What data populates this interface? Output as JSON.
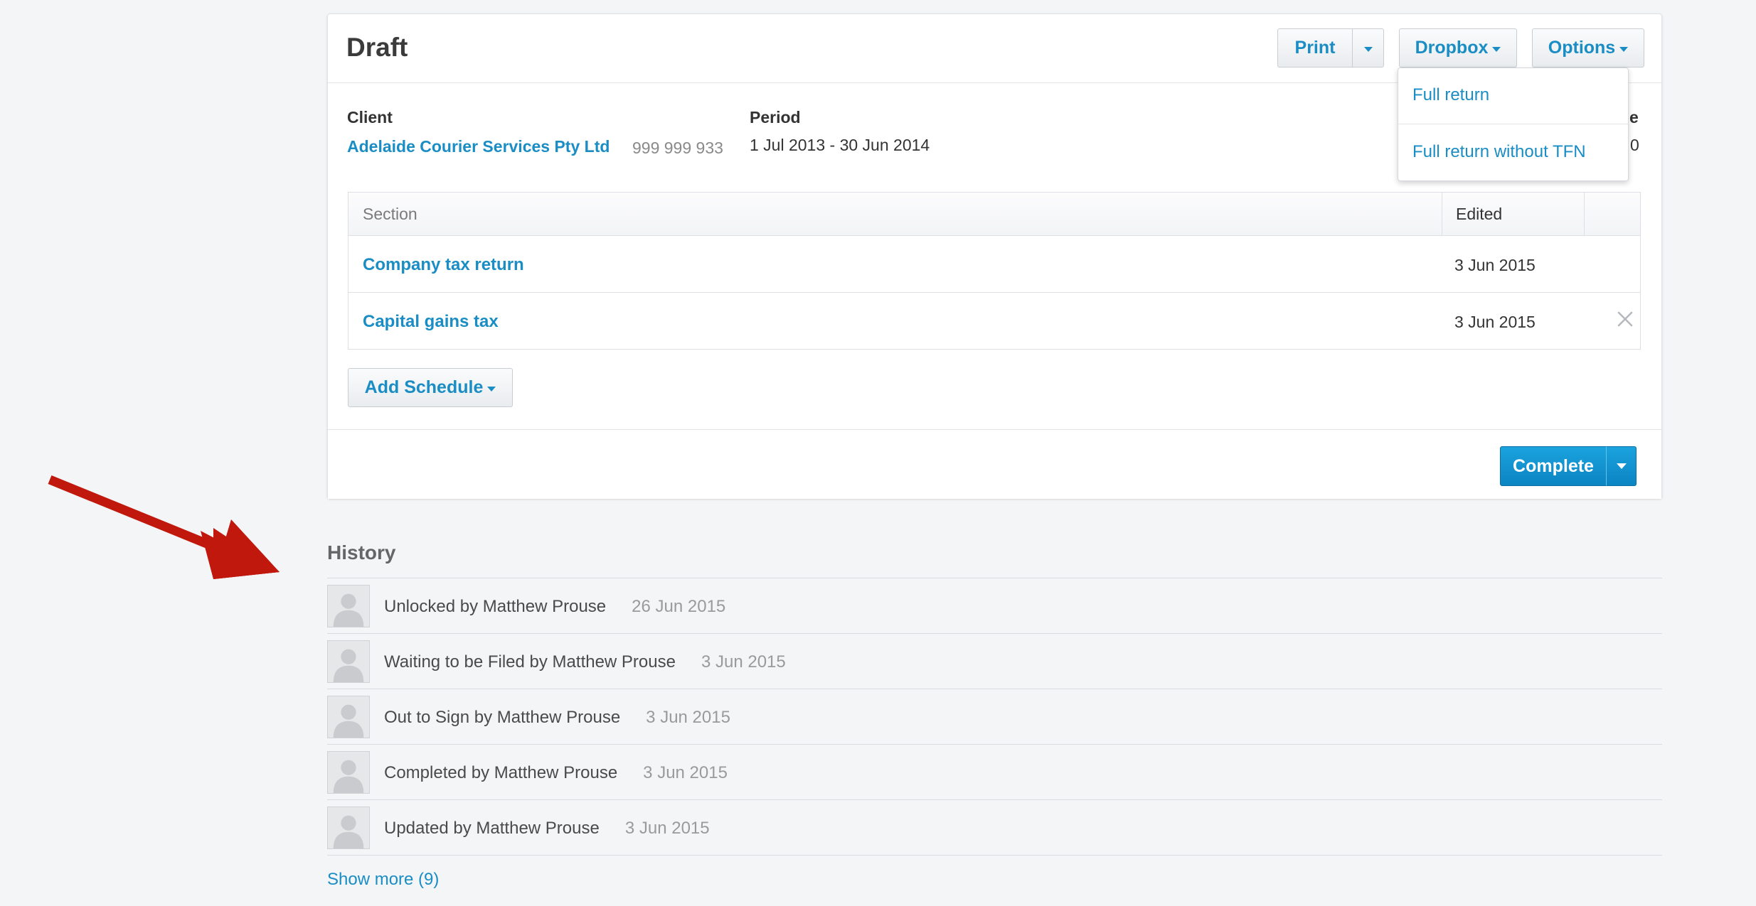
{
  "header": {
    "title": "Draft",
    "print_label": "Print",
    "dropbox_label": "Dropbox",
    "options_label": "Options"
  },
  "dropdown": {
    "items": [
      {
        "label": "Full return"
      },
      {
        "label": "Full return without TFN"
      }
    ]
  },
  "details": {
    "client_label": "Client",
    "client_name": "Adelaide Courier Services Pty Ltd",
    "client_abn": "999 999 933",
    "period_label": "Period",
    "period_value": "1 Jul 2013 - 30 Jun 2014",
    "partial_label": "e",
    "partial_value": "0"
  },
  "sections_table": {
    "headers": {
      "section": "Section",
      "edited": "Edited"
    },
    "rows": [
      {
        "name": "Company tax return",
        "edited": "3 Jun 2015",
        "deletable": false
      },
      {
        "name": "Capital gains tax",
        "edited": "3 Jun 2015",
        "deletable": true
      }
    ]
  },
  "add_schedule_label": "Add Schedule",
  "complete_label": "Complete",
  "history": {
    "title": "History",
    "items": [
      {
        "text": "Unlocked by Matthew Prouse",
        "date": "26 Jun 2015"
      },
      {
        "text": "Waiting to be Filed by Matthew Prouse",
        "date": "3 Jun 2015"
      },
      {
        "text": "Out to Sign by Matthew Prouse",
        "date": "3 Jun 2015"
      },
      {
        "text": "Completed by Matthew Prouse",
        "date": "3 Jun 2015"
      },
      {
        "text": "Updated by Matthew Prouse",
        "date": "3 Jun 2015"
      }
    ],
    "show_more_label": "Show more (9)"
  },
  "colors": {
    "link": "#1a8dc4",
    "primary_button": "#0b84c2",
    "annotation_arrow": "#c0180c",
    "background": "#f4f5f7"
  },
  "icons": {
    "delete": "close-icon",
    "dropdown": "chevron-down-icon",
    "avatar": "user-silhouette-icon",
    "annotation": "red-arrow"
  }
}
